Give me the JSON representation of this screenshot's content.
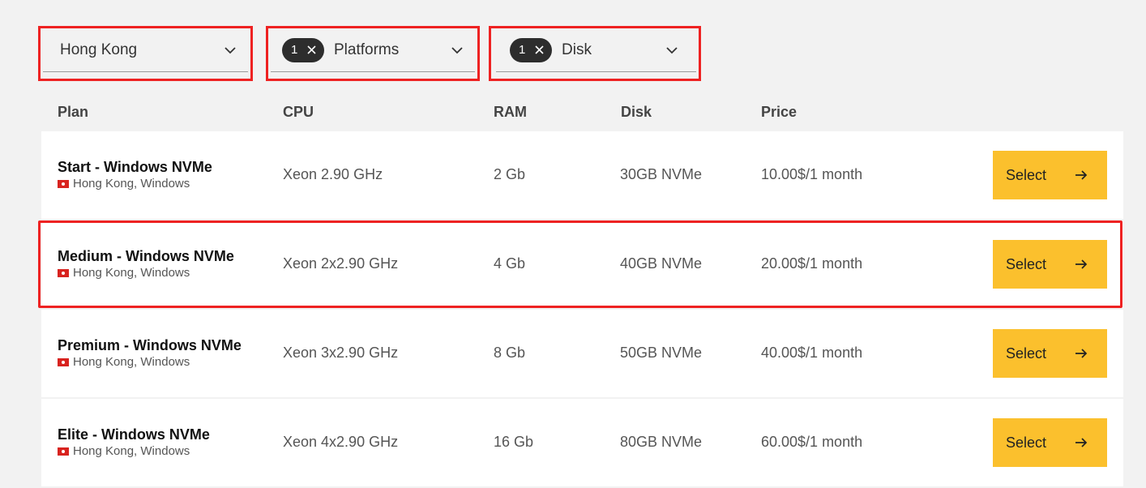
{
  "filters": {
    "location": {
      "label": "Hong Kong"
    },
    "platforms": {
      "count": "1",
      "label": "Platforms"
    },
    "disk": {
      "count": "1",
      "label": "Disk"
    }
  },
  "table": {
    "headers": {
      "plan": "Plan",
      "cpu": "CPU",
      "ram": "RAM",
      "disk": "Disk",
      "price": "Price"
    },
    "rows": [
      {
        "name": "Start - Windows NVMe",
        "location": "Hong Kong, Windows",
        "cpu": "Xeon 2.90 GHz",
        "ram": "2 Gb",
        "disk": "30GB NVMe",
        "price": "10.00$/1 month",
        "button": "Select"
      },
      {
        "name": "Medium - Windows NVMe",
        "location": "Hong Kong, Windows",
        "cpu": "Xeon 2x2.90 GHz",
        "ram": "4 Gb",
        "disk": "40GB NVMe",
        "price": "20.00$/1 month",
        "button": "Select"
      },
      {
        "name": "Premium - Windows NVMe",
        "location": "Hong Kong, Windows",
        "cpu": "Xeon 3x2.90 GHz",
        "ram": "8 Gb",
        "disk": "50GB NVMe",
        "price": "40.00$/1 month",
        "button": "Select"
      },
      {
        "name": "Elite - Windows NVMe",
        "location": "Hong Kong, Windows",
        "cpu": "Xeon 4x2.90 GHz",
        "ram": "16 Gb",
        "disk": "80GB NVMe",
        "price": "60.00$/1 month",
        "button": "Select"
      }
    ]
  },
  "icons": {
    "dropdown": "chevron-down-icon",
    "remove": "close-icon",
    "select": "arrow-right-icon",
    "flag": "hong-kong-flag-icon"
  },
  "colors": {
    "button": "#fbc02d",
    "highlight": "#ee2222",
    "chip": "#2d2d2d"
  }
}
